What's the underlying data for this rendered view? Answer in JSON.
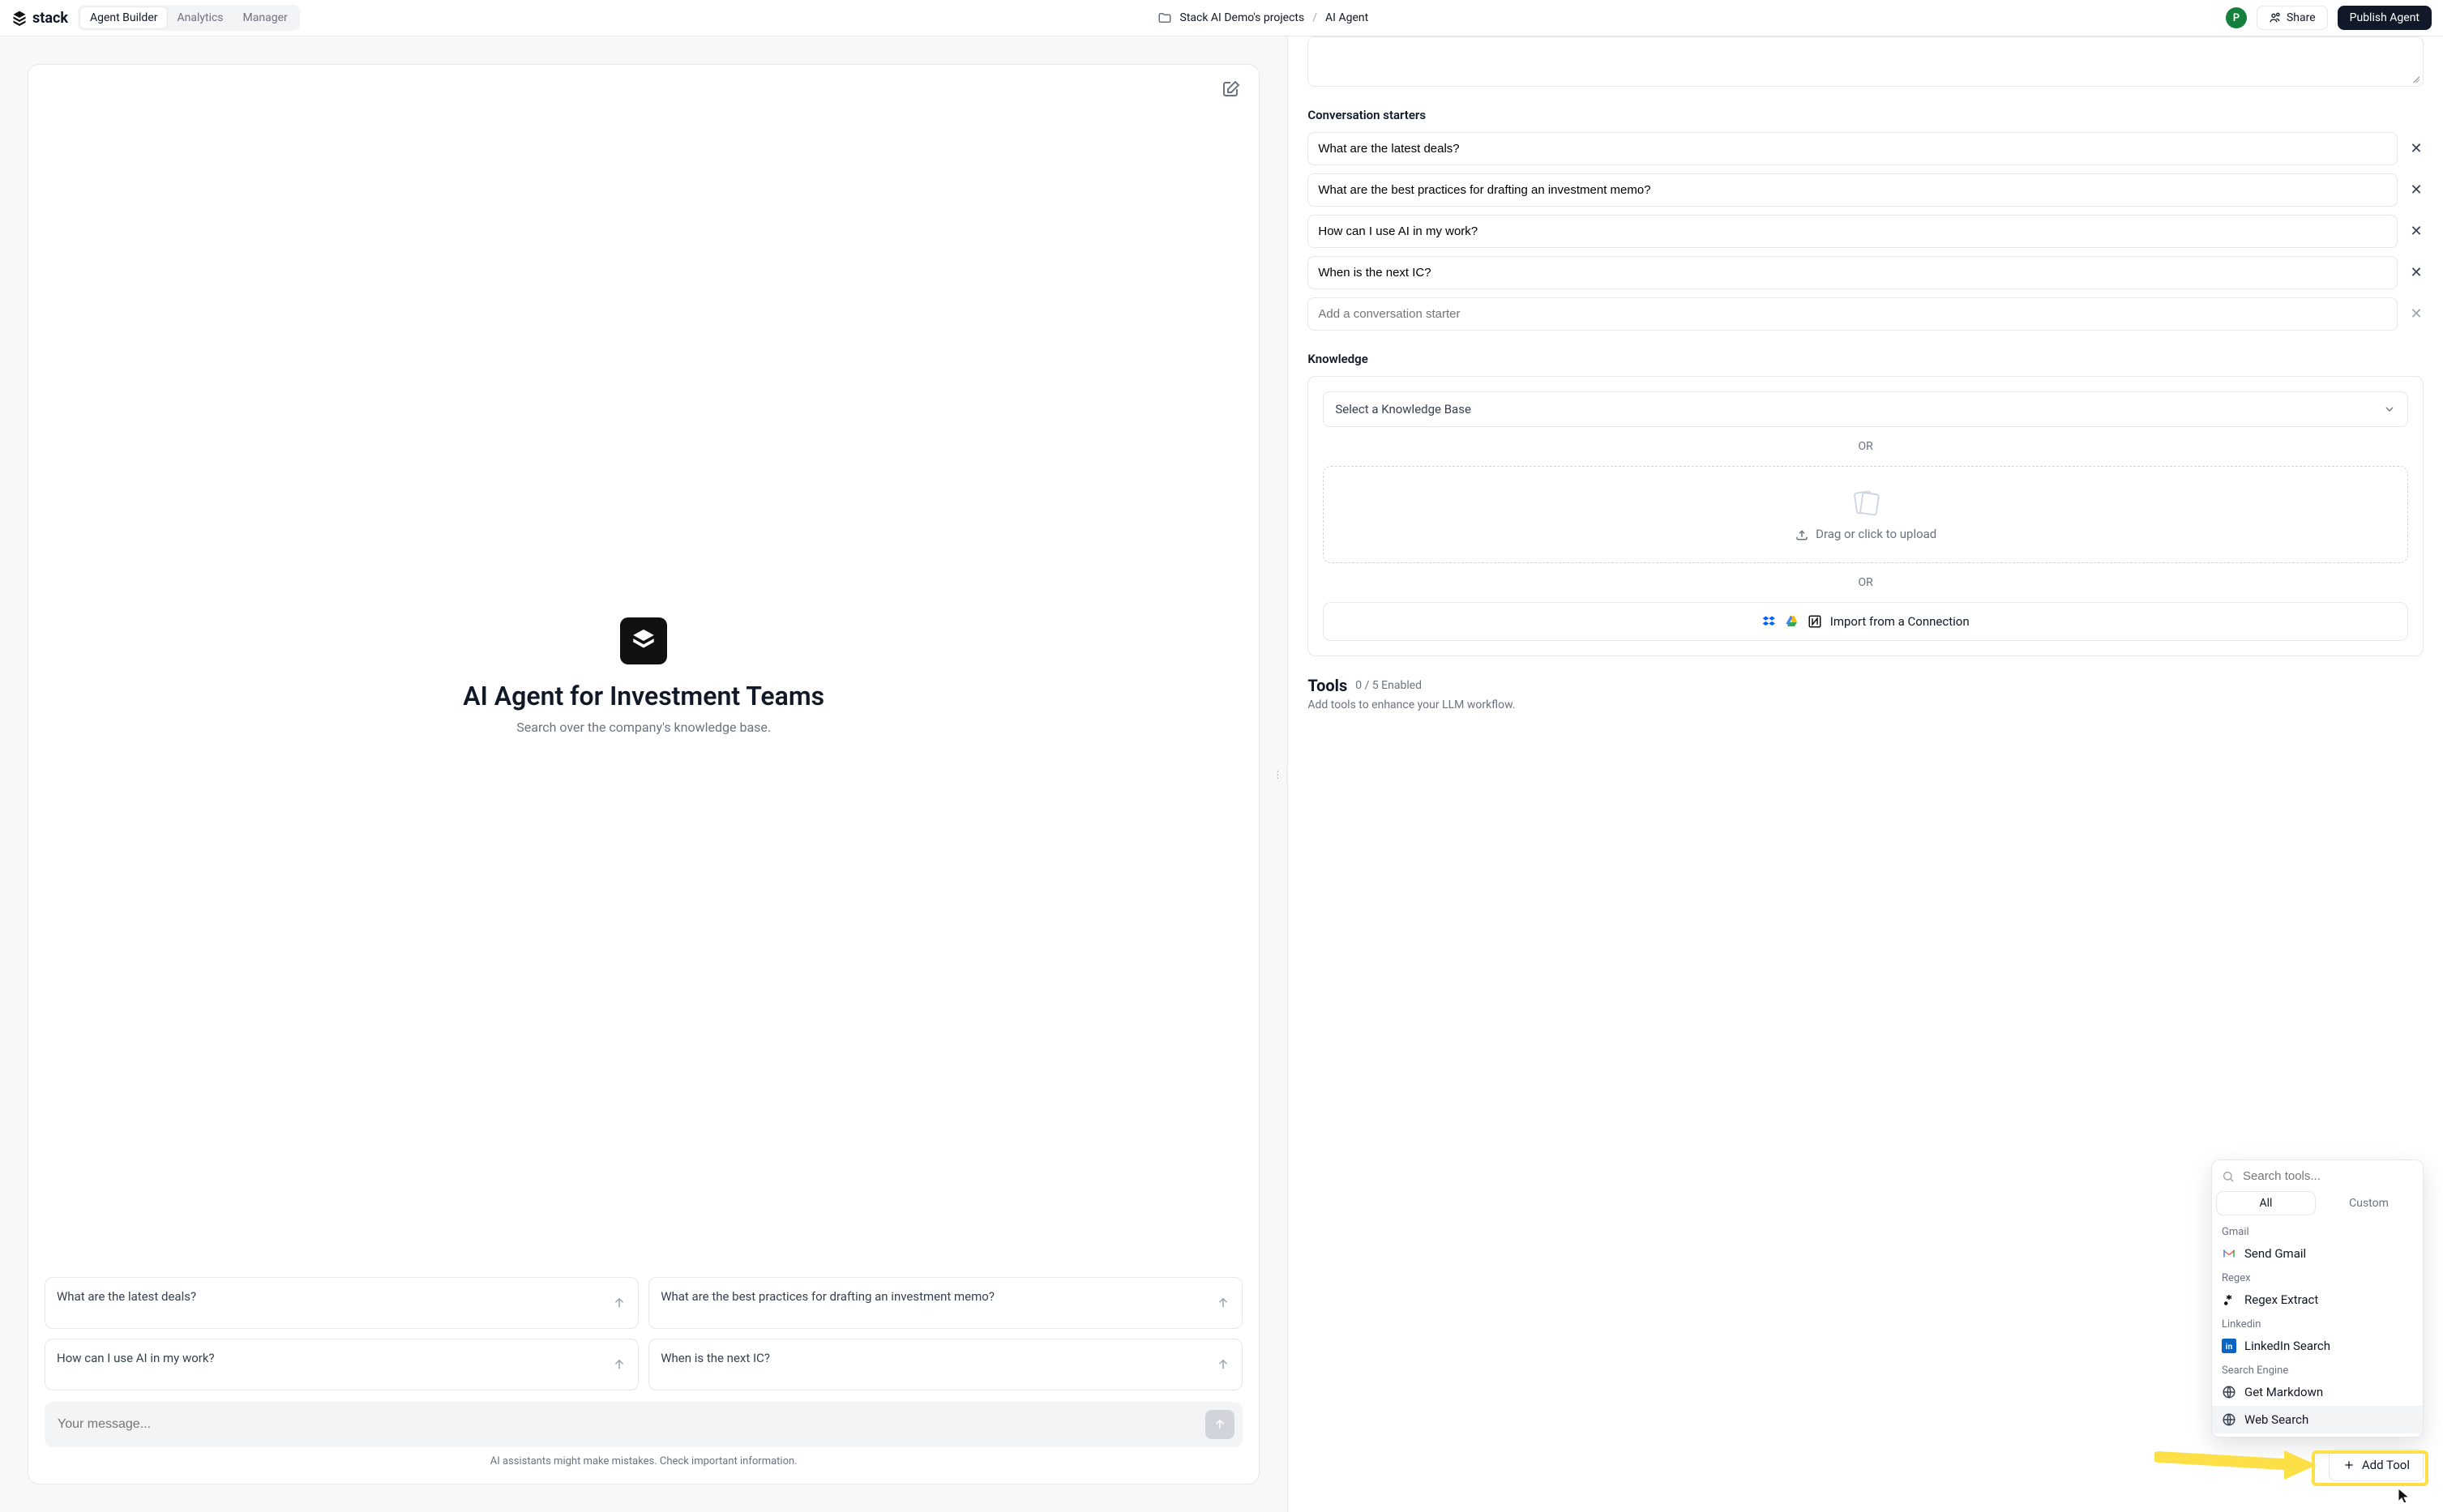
{
  "brand": "stack",
  "top_tabs": {
    "builder": "Agent Builder",
    "analytics": "Analytics",
    "manager": "Manager"
  },
  "breadcrumb": {
    "project": "Stack AI Demo's projects",
    "agent": "AI Agent"
  },
  "avatar_initial": "P",
  "buttons": {
    "share": "Share",
    "publish": "Publish Agent",
    "add_tool": "Add Tool"
  },
  "preview": {
    "title": "AI Agent for Investment Teams",
    "subtitle": "Search over the company's knowledge base.",
    "suggestions": [
      "What are the latest deals?",
      "What are the best practices for drafting an investment memo?",
      "How can I use AI in my work?",
      "When is the next IC?"
    ],
    "message_placeholder": "Your message...",
    "disclaimer": "AI assistants might make mistakes. Check important information."
  },
  "config": {
    "starters_label": "Conversation starters",
    "starters": [
      "What are the latest deals?",
      "What are the best practices for drafting an investment memo?",
      "How can I use AI in my work?",
      "When is the next IC?"
    ],
    "starter_placeholder": "Add a conversation starter",
    "knowledge_label": "Knowledge",
    "kb_select_placeholder": "Select a Knowledge Base",
    "or": "OR",
    "drop_label": "Drag or click to upload",
    "import_label": "Import from a Connection",
    "tools_label": "Tools",
    "tools_count": "0 / 5 Enabled",
    "tools_sub": "Add tools to enhance your LLM workflow."
  },
  "tool_popover": {
    "search_placeholder": "Search tools...",
    "tab_all": "All",
    "tab_custom": "Custom",
    "groups": [
      {
        "name": "Gmail",
        "items": [
          {
            "label": "Send Gmail",
            "icon": "gmail"
          }
        ]
      },
      {
        "name": "Regex",
        "items": [
          {
            "label": "Regex Extract",
            "icon": "regex"
          }
        ]
      },
      {
        "name": "Linkedin",
        "items": [
          {
            "label": "LinkedIn Search",
            "icon": "linkedin"
          }
        ]
      },
      {
        "name": "Search Engine",
        "items": [
          {
            "label": "Get Markdown",
            "icon": "globe"
          },
          {
            "label": "Web Search",
            "icon": "globe",
            "hover": true
          }
        ]
      }
    ]
  }
}
